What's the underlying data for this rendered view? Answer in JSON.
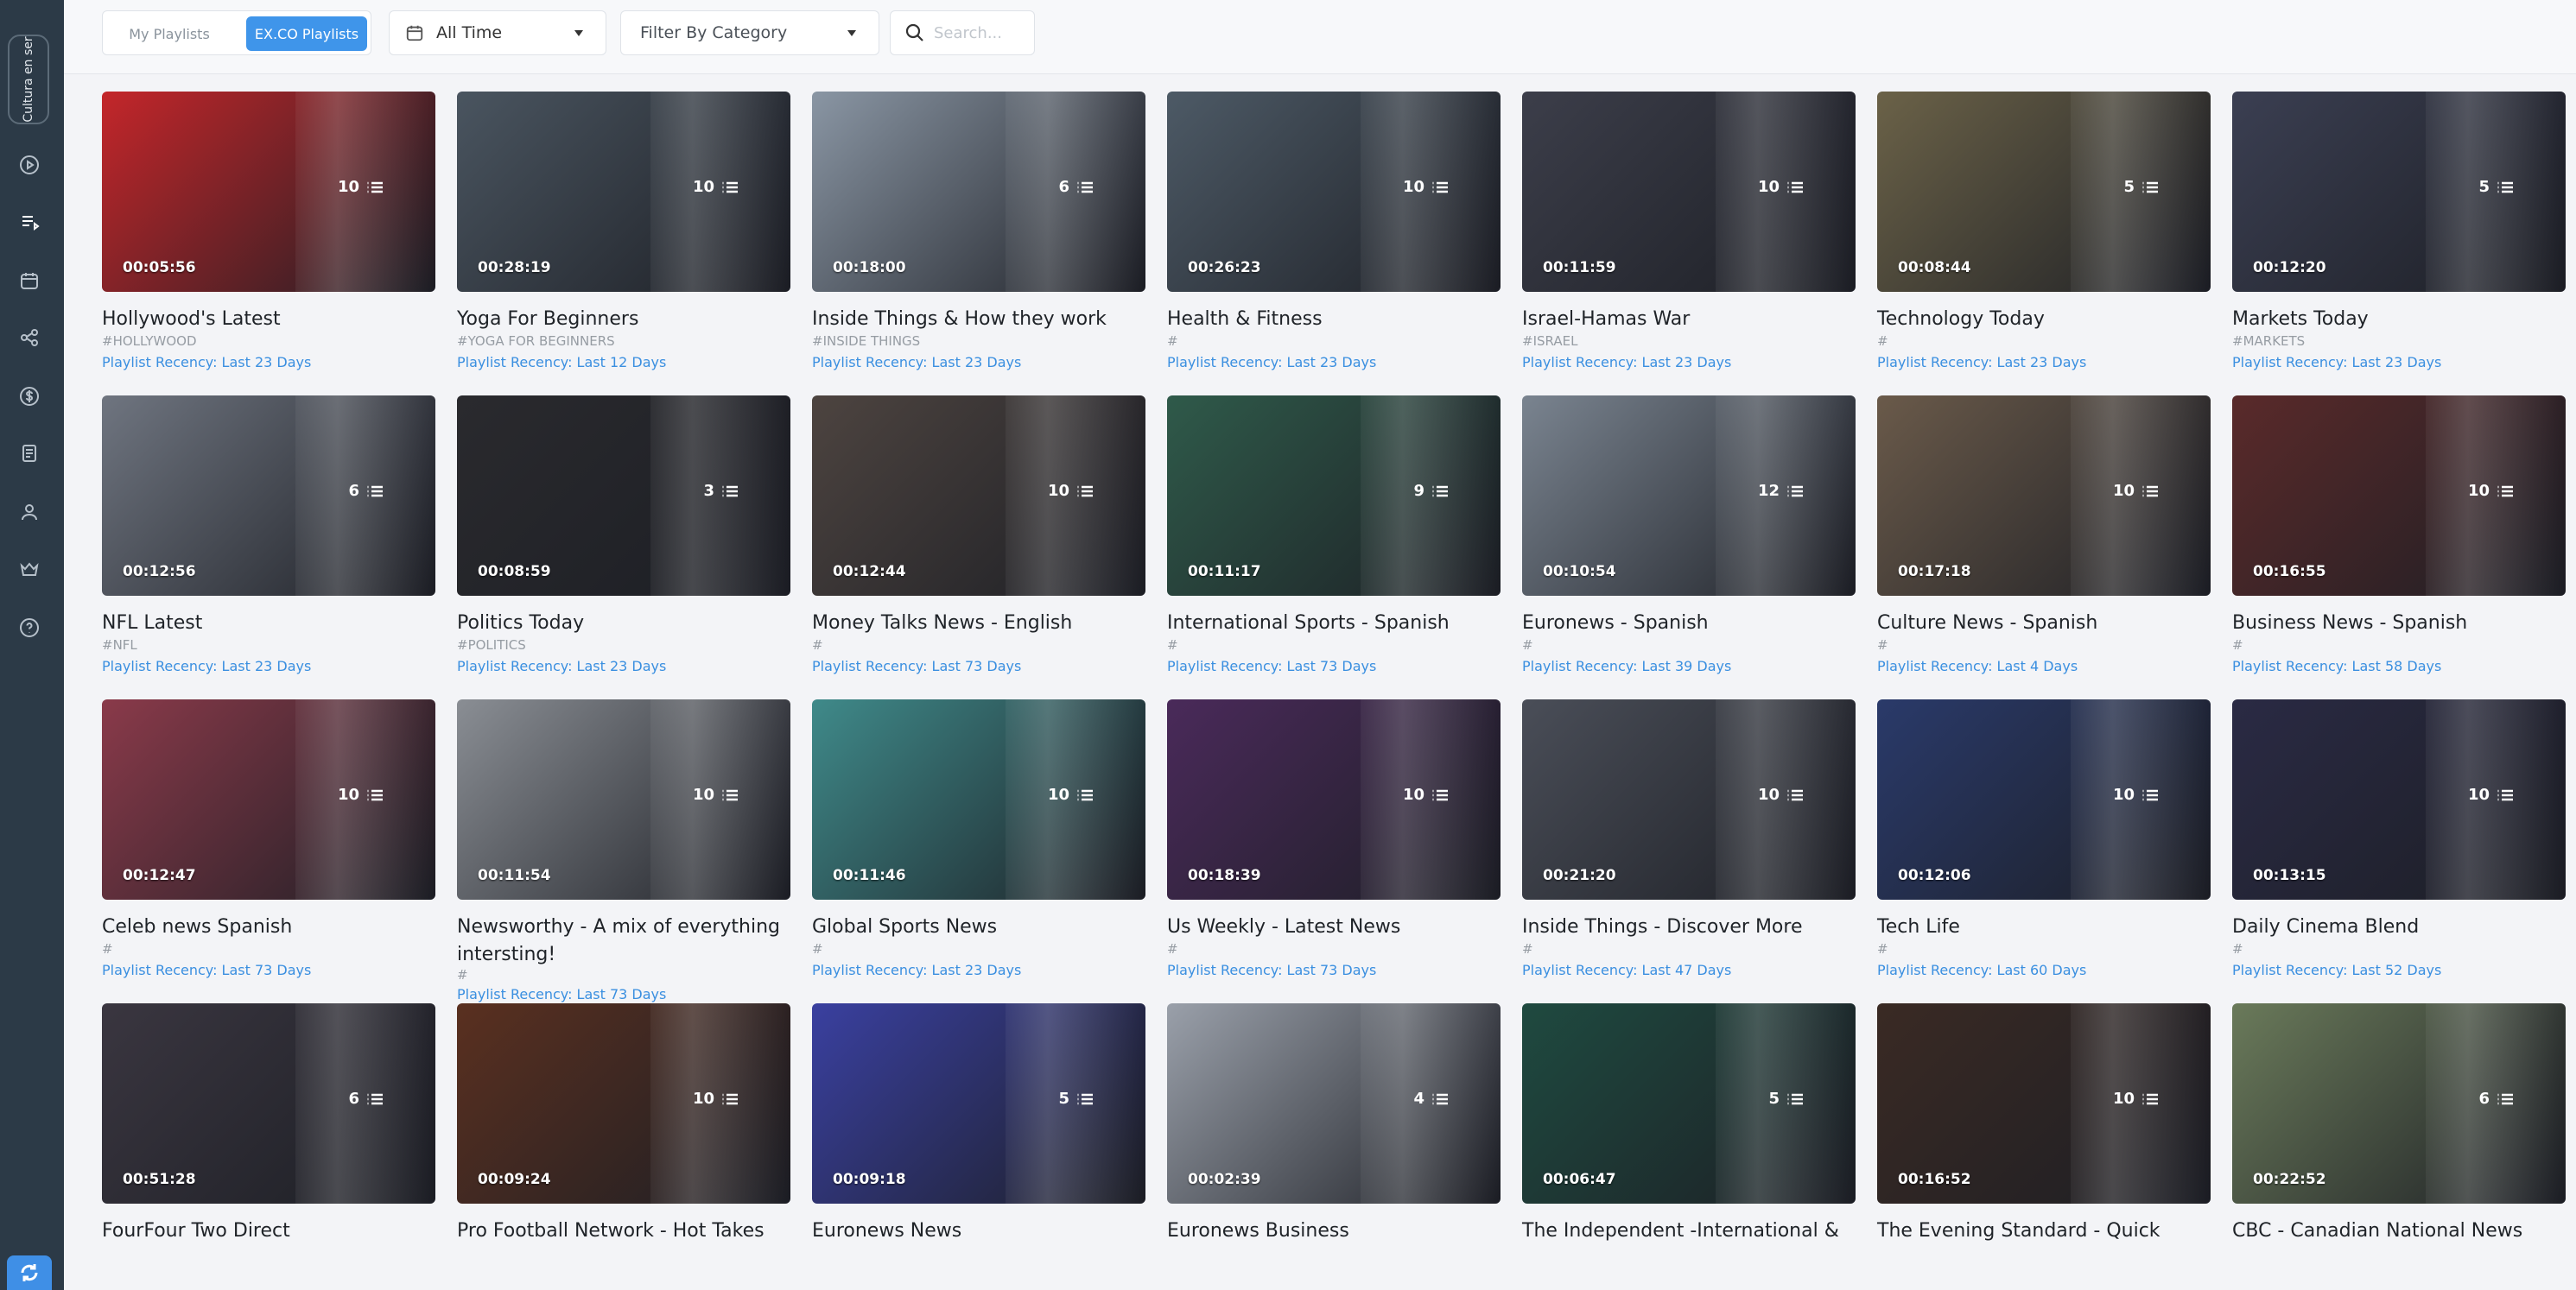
{
  "sidebar": {
    "org_label": "Cultura en ser",
    "icons": [
      "play-icon",
      "playlist-icon",
      "calendar-icon",
      "share-icon",
      "dollar-icon",
      "document-icon",
      "user-icon",
      "crown-icon",
      "help-icon",
      "app-logo-icon"
    ]
  },
  "toolbar": {
    "tabs": [
      "My Playlists",
      "EX.CO Playlists"
    ],
    "active_tab": "EX.CO Playlists",
    "time_filter": "All Time",
    "category_filter": "Filter By Category",
    "search_placeholder": "Search..."
  },
  "colors": {
    "accent": "#3f95ea",
    "sidebar": "#2c3a47",
    "link": "#3a8fe0"
  },
  "playlists": [
    {
      "title": "Hollywood's Latest",
      "tag": "#HOLLYWOOD",
      "recency": "Playlist Recency: Last 23 Days",
      "count": "10",
      "duration": "00:05:56",
      "thumb": "#c4262a"
    },
    {
      "title": "Yoga For Beginners",
      "tag": "#YOGA FOR BEGINNERS",
      "recency": "Playlist Recency: Last 12 Days",
      "count": "10",
      "duration": "00:28:19",
      "thumb": "#4a5560"
    },
    {
      "title": "Inside Things & How they work",
      "tag": "#INSIDE THINGS",
      "recency": "Playlist Recency: Last 23 Days",
      "count": "6",
      "duration": "00:18:00",
      "thumb": "#8a96a4"
    },
    {
      "title": "Health & Fitness",
      "tag": "#",
      "recency": "Playlist Recency: Last 23 Days",
      "count": "10",
      "duration": "00:26:23",
      "thumb": "#4d5a66"
    },
    {
      "title": "Israel-Hamas War",
      "tag": "#ISRAEL",
      "recency": "Playlist Recency: Last 23 Days",
      "count": "10",
      "duration": "00:11:59",
      "thumb": "#3c3e4a"
    },
    {
      "title": "Technology Today",
      "tag": "#",
      "recency": "Playlist Recency: Last 23 Days",
      "count": "5",
      "duration": "00:08:44",
      "thumb": "#6b6248"
    },
    {
      "title": "Markets Today",
      "tag": "#MARKETS",
      "recency": "Playlist Recency: Last 23 Days",
      "count": "5",
      "duration": "00:12:20",
      "thumb": "#3b3f52"
    },
    {
      "title": "NFL Latest",
      "tag": "#NFL",
      "recency": "Playlist Recency: Last 23 Days",
      "count": "6",
      "duration": "00:12:56",
      "thumb": "#6f7580"
    },
    {
      "title": "Politics Today",
      "tag": "#POLITICS",
      "recency": "Playlist Recency: Last 23 Days",
      "count": "3",
      "duration": "00:08:59",
      "thumb": "#2a2a2e"
    },
    {
      "title": "Money Talks News - English",
      "tag": "#",
      "recency": "Playlist Recency: Last 73 Days",
      "count": "10",
      "duration": "00:12:44",
      "thumb": "#4d4440"
    },
    {
      "title": "International Sports - Spanish",
      "tag": "#",
      "recency": "Playlist Recency: Last 73 Days",
      "count": "9",
      "duration": "00:11:17",
      "thumb": "#2f5a4a"
    },
    {
      "title": "Euronews - Spanish",
      "tag": "#",
      "recency": "Playlist Recency: Last 39 Days",
      "count": "12",
      "duration": "00:10:54",
      "thumb": "#7a8490"
    },
    {
      "title": "Culture News - Spanish",
      "tag": "#",
      "recency": "Playlist Recency: Last 4 Days",
      "count": "10",
      "duration": "00:17:18",
      "thumb": "#6a5a4a"
    },
    {
      "title": "Business News - Spanish",
      "tag": "#",
      "recency": "Playlist Recency: Last 58 Days",
      "count": "10",
      "duration": "00:16:55",
      "thumb": "#5a2a2a"
    },
    {
      "title": "Celeb news Spanish",
      "tag": "#",
      "recency": "Playlist Recency: Last 73 Days",
      "count": "10",
      "duration": "00:12:47",
      "thumb": "#8a3a4a"
    },
    {
      "title": "Newsworthy - A mix of everything intersting!",
      "tag": "#",
      "recency": "Playlist Recency: Last 73 Days",
      "count": "10",
      "duration": "00:11:54",
      "thumb": "#8a8e94"
    },
    {
      "title": "Global Sports News",
      "tag": "#",
      "recency": "Playlist Recency: Last 23 Days",
      "count": "10",
      "duration": "00:11:46",
      "thumb": "#3f8a8a"
    },
    {
      "title": "Us Weekly - Latest News",
      "tag": "#",
      "recency": "Playlist Recency: Last 73 Days",
      "count": "10",
      "duration": "00:18:39",
      "thumb": "#4a2a5a"
    },
    {
      "title": "Inside Things - Discover More",
      "tag": "#",
      "recency": "Playlist Recency: Last 47 Days",
      "count": "10",
      "duration": "00:21:20",
      "thumb": "#4a4e58"
    },
    {
      "title": "Tech Life",
      "tag": "#",
      "recency": "Playlist Recency: Last 60 Days",
      "count": "10",
      "duration": "00:12:06",
      "thumb": "#2a3a6a"
    },
    {
      "title": "Daily Cinema Blend",
      "tag": "#",
      "recency": "Playlist Recency: Last 52 Days",
      "count": "10",
      "duration": "00:13:15",
      "thumb": "#2a2a44"
    },
    {
      "title": "FourFour Two Direct",
      "tag": "",
      "recency": "",
      "count": "6",
      "duration": "00:51:28",
      "thumb": "#3a3640"
    },
    {
      "title": "Pro Football Network - Hot Takes",
      "tag": "",
      "recency": "",
      "count": "10",
      "duration": "00:09:24",
      "thumb": "#5a3020"
    },
    {
      "title": "Euronews News",
      "tag": "",
      "recency": "",
      "count": "5",
      "duration": "00:09:18",
      "thumb": "#3a40a0"
    },
    {
      "title": "Euronews Business",
      "tag": "",
      "recency": "",
      "count": "4",
      "duration": "00:02:39",
      "thumb": "#9aa0aa"
    },
    {
      "title": "The Independent -International &",
      "tag": "",
      "recency": "",
      "count": "5",
      "duration": "00:06:47",
      "thumb": "#1f4a40"
    },
    {
      "title": "The Evening Standard - Quick",
      "tag": "",
      "recency": "",
      "count": "10",
      "duration": "00:16:52",
      "thumb": "#3a2a24"
    },
    {
      "title": "CBC - Canadian National News",
      "tag": "",
      "recency": "",
      "count": "6",
      "duration": "00:22:52",
      "thumb": "#6a7a5a"
    }
  ]
}
